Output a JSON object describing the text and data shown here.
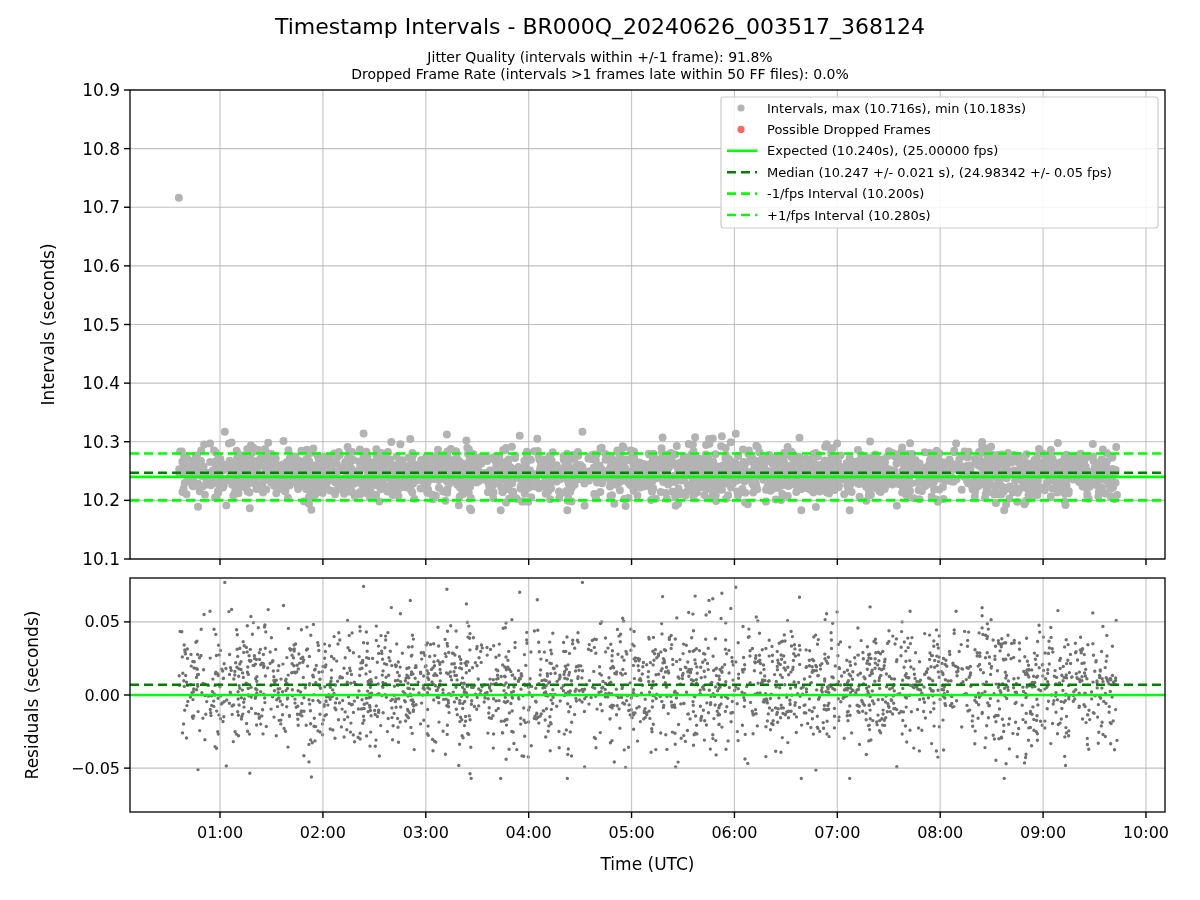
{
  "figure": {
    "title": "Timestamp Intervals - BR000Q_20240626_003517_368124",
    "subtitles": [
      "Jitter Quality (intervals within +/-1 frame): 91.8%",
      "Dropped Frame Rate (intervals >1 frames late within 50 FF files): 0.0%"
    ]
  },
  "intervals_panel": {
    "chart_data": {
      "type": "line",
      "ylabel": "Intervals (seconds)",
      "grid": true,
      "legend": "upper right",
      "x": [
        0.125,
        0.6,
        10.185
      ],
      "xlim": [
        0.125,
        10.185
      ],
      "ylim": [
        10.1,
        10.9
      ],
      "yticks": [
        {
          "value": 10.1,
          "label": "10.1"
        },
        {
          "value": 10.2,
          "label": "10.2"
        },
        {
          "value": 10.3,
          "label": "10.3"
        },
        {
          "value": 10.4,
          "label": "10.4"
        },
        {
          "value": 10.5,
          "label": "10.5"
        },
        {
          "value": 10.6,
          "label": "10.6"
        },
        {
          "value": 10.7,
          "label": "10.7"
        },
        {
          "value": 10.8,
          "label": "10.8"
        },
        {
          "value": 10.9,
          "label": "10.9"
        }
      ],
      "series": [
        {
          "name": "Intervals, max (10.716s), min (10.183s)",
          "type": "scatter",
          "color": "#808080",
          "values": [
            null,
            10.716,
            null
          ]
        },
        {
          "name": "Possible Dropped Frames",
          "type": "scatter",
          "color": "#ff0000",
          "values": [
            null,
            null,
            null
          ]
        },
        {
          "name": "Expected (10.240s), (25.00000 fps)",
          "type": "line",
          "color": "#00ff00",
          "values": [
            10.24,
            10.24,
            10.24
          ]
        },
        {
          "name": "Median (10.247 +/- 0.021 s), (24.98342 +/- 0.05 fps)",
          "type": "line",
          "line_style": "dashed",
          "color": "#008000",
          "values": [
            10.247,
            10.247,
            10.247
          ]
        },
        {
          "name": "-1/fps Interval (10.200s)",
          "type": "line",
          "line_style": "dashed",
          "color": "#00ff00",
          "values": [
            10.2,
            10.2,
            10.2
          ]
        },
        {
          "name": "+1/fps Interval (10.280s)",
          "type": "line",
          "line_style": "dashed",
          "color": "#00ff00",
          "values": [
            10.28,
            10.28,
            10.28
          ]
        }
      ]
    }
  },
  "residuals_panel": {
    "chart_data": {
      "type": "line",
      "xlabel": "Time (UTC)",
      "ylabel": "Residuals (seconds)",
      "grid": true,
      "x": [
        0.125,
        10.185
      ],
      "xlim": [
        0.125,
        10.185
      ],
      "ylim": [
        -0.08,
        0.08
      ],
      "xticks": [
        {
          "value": 1,
          "label": "01:00"
        },
        {
          "value": 2,
          "label": "02:00"
        },
        {
          "value": 3,
          "label": "03:00"
        },
        {
          "value": 4,
          "label": "04:00"
        },
        {
          "value": 5,
          "label": "05:00"
        },
        {
          "value": 6,
          "label": "06:00"
        },
        {
          "value": 7,
          "label": "07:00"
        },
        {
          "value": 8,
          "label": "08:00"
        },
        {
          "value": 9,
          "label": "09:00"
        },
        {
          "value": 10,
          "label": "10:00"
        }
      ],
      "yticks": [
        {
          "value": -0.05,
          "label": "−0.05"
        },
        {
          "value": 0,
          "label": "0.00"
        },
        {
          "value": 0.05,
          "label": "0.05"
        }
      ],
      "series": [
        {
          "type": "line",
          "color": "#00ff00",
          "values": [
            0,
            0
          ]
        },
        {
          "type": "line",
          "line_style": "dashed",
          "color": "#008000",
          "values": [
            0.007,
            0.007
          ]
        }
      ]
    }
  }
}
